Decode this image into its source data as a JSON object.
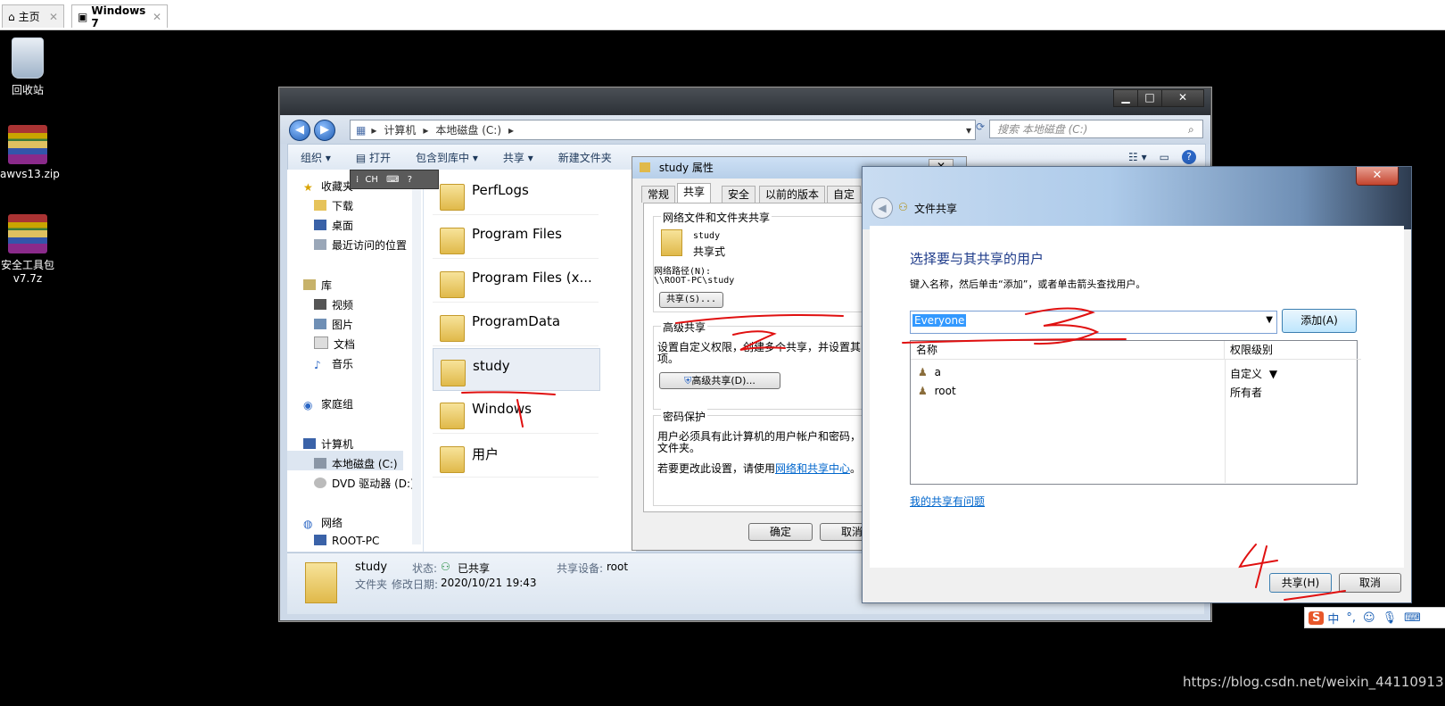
{
  "host": {
    "tabs": [
      {
        "label": "主页"
      },
      {
        "label": "Windows 7"
      }
    ]
  },
  "desktop": {
    "icons": [
      {
        "label": "回收站",
        "icon": "recycle-bin-icon"
      },
      {
        "label": "awvs13.zip",
        "icon": "winrar-archive-icon"
      },
      {
        "label": "安全工具包 v7.7z",
        "icon": "winrar-archive-icon"
      }
    ]
  },
  "explorer": {
    "breadcrumb": [
      "计算机",
      "本地磁盘 (C:)"
    ],
    "search_placeholder": "搜索 本地磁盘 (C:)",
    "toolbar": [
      "组织",
      "打开",
      "包含到库中",
      "共享",
      "新建文件夹"
    ],
    "nav": {
      "favorites": "收藏夹",
      "downloads": "下载",
      "desktop": "桌面",
      "recent": "最近访问的位置",
      "libraries": "库",
      "videos": "视频",
      "pictures": "图片",
      "documents": "文档",
      "music": "音乐",
      "homegroup": "家庭组",
      "computer": "计算机",
      "local_disk": "本地磁盘 (C:)",
      "dvd": "DVD 驱动器 (D:)",
      "network": "网络",
      "root_pc": "ROOT-PC"
    },
    "folders": [
      "PerfLogs",
      "Program Files",
      "Program Files (x...",
      "ProgramData",
      "study",
      "Windows",
      "用户"
    ],
    "status": {
      "name": "study",
      "state_label": "状态:",
      "state_value": "已共享",
      "share_dev_label": "共享设备:",
      "share_dev_value": "root",
      "type": "文件夹",
      "modified_label": "修改日期:",
      "modified_value": "2020/10/21 19:43"
    }
  },
  "ime_toolbar": {
    "text": "CH"
  },
  "props": {
    "title": "study 属性",
    "tabs": [
      "常规",
      "共享",
      "安全",
      "以前的版本",
      "自定"
    ],
    "net_group": "网络文件和文件夹共享",
    "folder_name": "study",
    "folder_state": "共享式",
    "net_path_label": "网络路径(N):",
    "net_path": "\\\\ROOT-PC\\study",
    "share_button": "共享(S)...",
    "adv_group": "高级共享",
    "adv_desc": "设置自定义权限，创建多个共享，并设置其",
    "adv_desc2": "项。",
    "adv_button": "高级共享(D)...",
    "pwd_group": "密码保护",
    "pwd_desc": "用户必须具有此计算机的用户帐户和密码，",
    "pwd_desc2": "文件夹。",
    "pwd_change": "若要更改此设置，请使用",
    "pwd_link": "网络和共享中心",
    "ok": "确定",
    "cancel": "取消"
  },
  "share": {
    "title": "文件共享",
    "heading": "选择要与其共享的用户",
    "instruction": "键入名称，然后单击“添加”，或者单击箭头查找用户。",
    "input_value": "Everyone",
    "add_button": "添加(A)",
    "columns": [
      "名称",
      "权限级别"
    ],
    "rows": [
      {
        "name": "a",
        "perm": "自定义"
      },
      {
        "name": "root",
        "perm": "所有者"
      }
    ],
    "help_link": "我的共享有问题",
    "share_button": "共享(H)",
    "cancel_button": "取消"
  },
  "tray": {
    "ime_label": "中"
  },
  "watermark": "https://blog.csdn.net/weixin_44110913"
}
